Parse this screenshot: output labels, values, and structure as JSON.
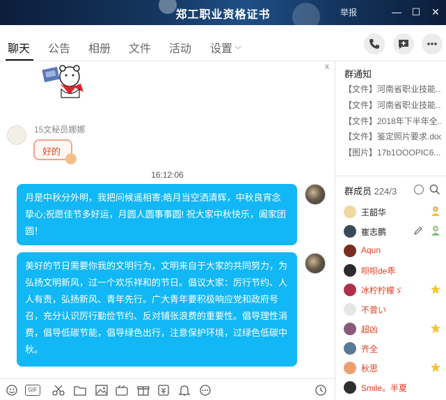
{
  "window": {
    "title": "郑工职业资格证书",
    "report_label": "举报",
    "minimize": "—",
    "maximize": "☐",
    "close": "✕"
  },
  "tabs": [
    {
      "label": "聊天"
    },
    {
      "label": "公告"
    },
    {
      "label": "相册"
    },
    {
      "label": "文件"
    },
    {
      "label": "活动"
    },
    {
      "label": "设置"
    }
  ],
  "chat": {
    "close_label": "x",
    "sender_name": "15文秘员娜娜",
    "sender_message": "好的",
    "timestamp": "16:12:06",
    "messages": [
      {
        "text": "月是中秋分外明，我把问候遥相寄;皓月当空洒清辉，中秋良宵念挚心;祝愿佳节多好运，月圆人圆事事圆! 祝大家中秋快乐，阖家团圆！"
      },
      {
        "text": "美好的节日需要你我的文明行为，文明来自于大家的共同努力，为弘扬文明新风，过一个欢乐祥和的节日。倡议大家：厉行节约、人人有责，弘扬新风、青年先行。广大青年要积极响应党和政府号召，充分认识厉行勤俭节约、反对铺张浪费的重要性。倡导理性消费，倡导低碳节能，倡导绿色出行，注意保护环境，过绿色低碳中秋。"
      }
    ]
  },
  "toolbar": {
    "gif_label": "GIF"
  },
  "notice": {
    "title": "群通知",
    "items": [
      {
        "text": "【文件】河南省职业技能..."
      },
      {
        "text": "【文件】河南省职业技能..."
      },
      {
        "text": "【文件】2018年下半年全..."
      },
      {
        "text": "【文件】鉴定照片要求.doc"
      },
      {
        "text": "【图片】17b1OOOPIC6..."
      }
    ]
  },
  "members": {
    "title": "群成员",
    "count": "224/3",
    "list": [
      {
        "name": "王韶华",
        "color": "#222222",
        "avatar_color": "#f0d7a3",
        "badge": "owner-icon"
      },
      {
        "name": "崔志鹏",
        "color": "#222222",
        "avatar_color": "#3b4a5a",
        "badge": "admin-icon"
      },
      {
        "name": "Aqun",
        "color": "#e03c1e",
        "avatar_color": "#7a2b22",
        "badge": ""
      },
      {
        "name": "呗呗de乖",
        "color": "#e03c1e",
        "avatar_color": "#2a2a2a",
        "badge": ""
      },
      {
        "name": "冰柠柠檬ゞ",
        "color": "#e03c1e",
        "avatar_color": "#b0304a",
        "badge": "star-icon"
      },
      {
        "name": "不曾い",
        "color": "#e03c1e",
        "avatar_color": "#e6e6e6",
        "badge": ""
      },
      {
        "name": "超凶",
        "color": "#e03c1e",
        "avatar_color": "#8a5a7a",
        "badge": "star-icon"
      },
      {
        "name": "齐全",
        "color": "#e03c1e",
        "avatar_color": "#5a7a96",
        "badge": ""
      },
      {
        "name": "秋思",
        "color": "#e03c1e",
        "avatar_color": "#e8a070",
        "badge": "star-icon"
      },
      {
        "name": "Smile。半夏",
        "color": "#e03c1e",
        "avatar_color": "#2f2f2f",
        "badge": ""
      }
    ]
  },
  "colors": {
    "bubble": "#12b7f5",
    "member_highlight": "#e03c1e",
    "star": "#f7c52b"
  }
}
